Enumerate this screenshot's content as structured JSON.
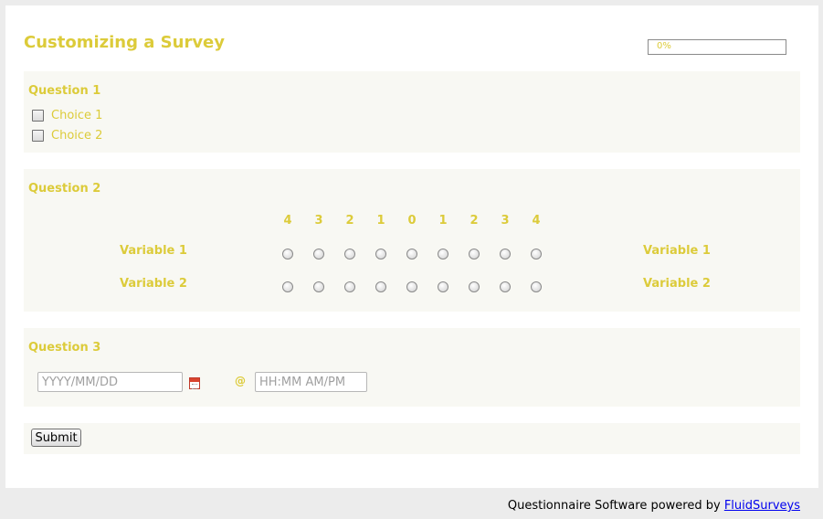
{
  "survey": {
    "title": "Customizing a Survey",
    "progress_text": "0%",
    "progress_value": 0
  },
  "question1": {
    "label": "Question 1",
    "choices": [
      "Choice 1",
      "Choice 2"
    ]
  },
  "question2": {
    "label": "Question 2",
    "scale": [
      "4",
      "3",
      "2",
      "1",
      "0",
      "1",
      "2",
      "3",
      "4"
    ],
    "rows": [
      {
        "left": "Variable 1",
        "right": "Variable 1"
      },
      {
        "left": "Variable 2",
        "right": "Variable 2"
      }
    ]
  },
  "question3": {
    "label": "Question 3",
    "date_placeholder": "YYYY/MM/DD",
    "at": "@",
    "time_placeholder": "HH:MM AM/PM"
  },
  "submit_label": "Submit",
  "footer": {
    "text": "Questionnaire Software powered by ",
    "link": "FluidSurveys"
  },
  "icons": {
    "calendar": "calendar-icon"
  },
  "colors": {
    "accent": "#dccb3a",
    "section_bg": "#f8f8f3",
    "page_bg": "#ececec"
  }
}
